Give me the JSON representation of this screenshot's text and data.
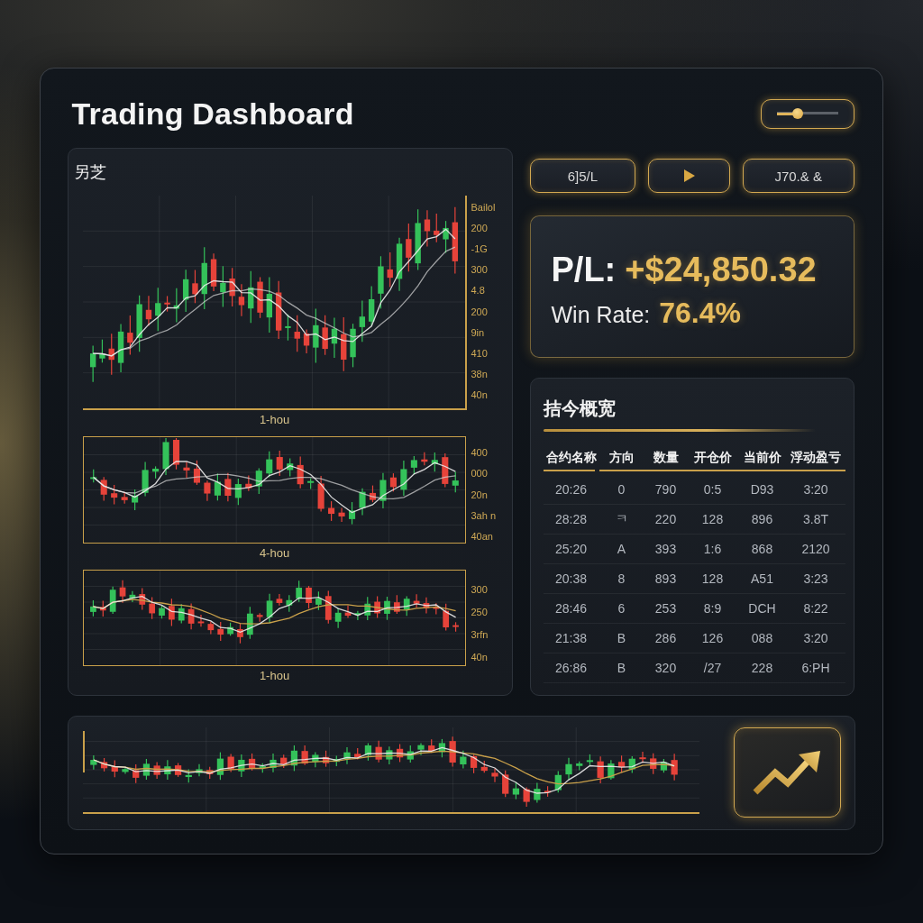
{
  "window": {
    "title": "Trading Dashboard"
  },
  "header_slider": {
    "level": 0.35
  },
  "chart_panel": {
    "title": "另芝",
    "charts": [
      {
        "kind": "axes",
        "axis_labels": [
          "Bailol",
          "200",
          "-1G",
          "300",
          "4.8",
          "200",
          "9in",
          "410",
          "38n",
          "40n"
        ],
        "caption": "1-hou"
      },
      {
        "kind": "framed",
        "axis_labels": [
          "400",
          "000",
          "20n",
          "3ah n",
          "40an"
        ],
        "caption": "4-hou"
      },
      {
        "kind": "framed",
        "axis_labels": [
          "300",
          "250",
          "3rfn",
          "40n"
        ],
        "caption": "1-hou"
      }
    ]
  },
  "toolbar": {
    "buttons": [
      {
        "kind": "text",
        "label": "6]5/L"
      },
      {
        "kind": "icon"
      },
      {
        "kind": "text",
        "label": "J70.& &"
      }
    ]
  },
  "summary": {
    "pl_label": "P/L:",
    "pl_value": "+$24,850.32",
    "win_rate_label": "Win Rate:",
    "win_rate_value": "76.4%"
  },
  "positions": {
    "title": "拮今概宽",
    "columns": [
      "合约名称",
      "方向",
      "数量",
      "开仓价",
      "当前价",
      "浮动盈亏"
    ],
    "rows": [
      [
        "20:26",
        "0",
        "790",
        "0:5",
        "D93",
        "3:20"
      ],
      [
        "28:28",
        "ㅋ",
        "220",
        "128",
        "896",
        "3.8T"
      ],
      [
        "25:20",
        "A",
        "393",
        "1:6",
        "868",
        "2120"
      ],
      [
        "20:38",
        "8",
        "893",
        "128",
        "A51",
        "3:23"
      ],
      [
        "28:46",
        "6",
        "253",
        "8:9",
        "DCH",
        "8:22"
      ],
      [
        "21:38",
        "B",
        "286",
        "126",
        "088",
        "3:20"
      ],
      [
        "26:86",
        "B",
        "320",
        "/27",
        "228",
        "6:PH"
      ]
    ]
  }
}
